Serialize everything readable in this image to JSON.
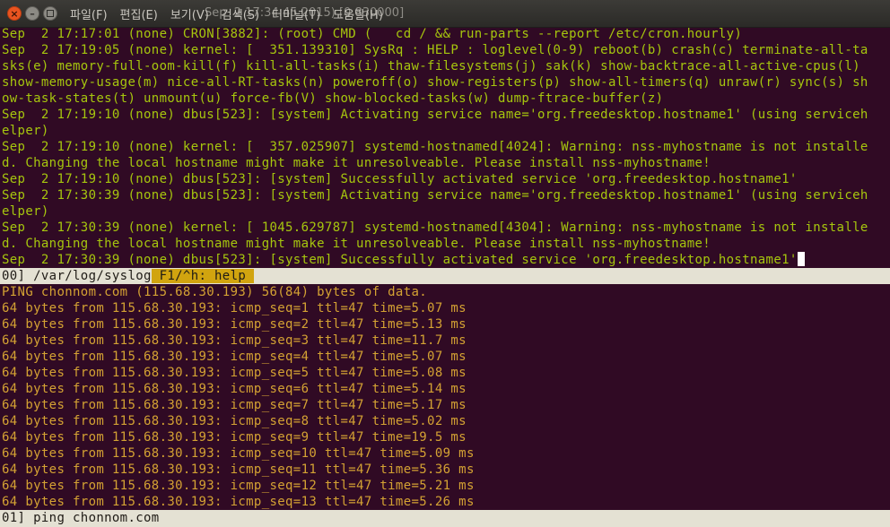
{
  "window": {
    "title": "Sep  2 17:34:45 2015) [0.830000]",
    "buttons": {
      "close": "×",
      "minimize": "–"
    }
  },
  "menubar": [
    {
      "label": "파일(F)"
    },
    {
      "label": "편집(E)"
    },
    {
      "label": "보기(V)"
    },
    {
      "label": "검색(S)"
    },
    {
      "label": "터미널(T)"
    },
    {
      "label": "도움말(H)"
    }
  ],
  "top_pane": {
    "lines": [
      "Sep  2 17:17:01 (none) CRON[3882]: (root) CMD (   cd / && run-parts --report /etc/cron.hourly)",
      "Sep  2 17:19:05 (none) kernel: [  351.139310] SysRq : HELP : loglevel(0-9) reboot(b) crash(c) terminate-all-ta",
      "sks(e) memory-full-oom-kill(f) kill-all-tasks(i) thaw-filesystems(j) sak(k) show-backtrace-all-active-cpus(l)",
      "show-memory-usage(m) nice-all-RT-tasks(n) poweroff(o) show-registers(p) show-all-timers(q) unraw(r) sync(s) sh",
      "ow-task-states(t) unmount(u) force-fb(V) show-blocked-tasks(w) dump-ftrace-buffer(z)",
      "Sep  2 17:19:10 (none) dbus[523]: [system] Activating service name='org.freedesktop.hostname1' (using serviceh",
      "elper)",
      "Sep  2 17:19:10 (none) kernel: [  357.025907] systemd-hostnamed[4024]: Warning: nss-myhostname is not installe",
      "d. Changing the local hostname might make it unresolveable. Please install nss-myhostname!",
      "Sep  2 17:19:10 (none) dbus[523]: [system] Successfully activated service 'org.freedesktop.hostname1'",
      "Sep  2 17:30:39 (none) dbus[523]: [system] Activating service name='org.freedesktop.hostname1' (using serviceh",
      "elper)",
      "Sep  2 17:30:39 (none) kernel: [ 1045.629787] systemd-hostnamed[4304]: Warning: nss-myhostname is not installe",
      "d. Changing the local hostname might make it unresolveable. Please install nss-myhostname!"
    ],
    "last_line": "Sep  2 17:30:39 (none) dbus[523]: [system] Successfully activated service 'org.freedesktop.hostname1'"
  },
  "top_status": {
    "path": "00] /var/log/syslog",
    "help": " F1/^h: help "
  },
  "bottom_pane": {
    "lines": [
      "PING chonnom.com (115.68.30.193) 56(84) bytes of data.",
      "64 bytes from 115.68.30.193: icmp_seq=1 ttl=47 time=5.07 ms",
      "64 bytes from 115.68.30.193: icmp_seq=2 ttl=47 time=5.13 ms",
      "64 bytes from 115.68.30.193: icmp_seq=3 ttl=47 time=11.7 ms",
      "64 bytes from 115.68.30.193: icmp_seq=4 ttl=47 time=5.07 ms",
      "64 bytes from 115.68.30.193: icmp_seq=5 ttl=47 time=5.08 ms",
      "64 bytes from 115.68.30.193: icmp_seq=6 ttl=47 time=5.14 ms",
      "64 bytes from 115.68.30.193: icmp_seq=7 ttl=47 time=5.17 ms",
      "64 bytes from 115.68.30.193: icmp_seq=8 ttl=47 time=5.02 ms",
      "64 bytes from 115.68.30.193: icmp_seq=9 ttl=47 time=19.5 ms",
      "64 bytes from 115.68.30.193: icmp_seq=10 ttl=47 time=5.09 ms",
      "64 bytes from 115.68.30.193: icmp_seq=11 ttl=47 time=5.36 ms",
      "64 bytes from 115.68.30.193: icmp_seq=12 ttl=47 time=5.21 ms",
      "64 bytes from 115.68.30.193: icmp_seq=13 ttl=47 time=5.26 ms"
    ]
  },
  "bottom_status": {
    "text": "01] ping chonnom.com"
  },
  "colors": {
    "background": "#300a24",
    "syslog_text": "#a6c60e",
    "ping_text": "#d4a233",
    "statusbar": "#e4e1d3",
    "help_highlight": "#d1a40f"
  }
}
